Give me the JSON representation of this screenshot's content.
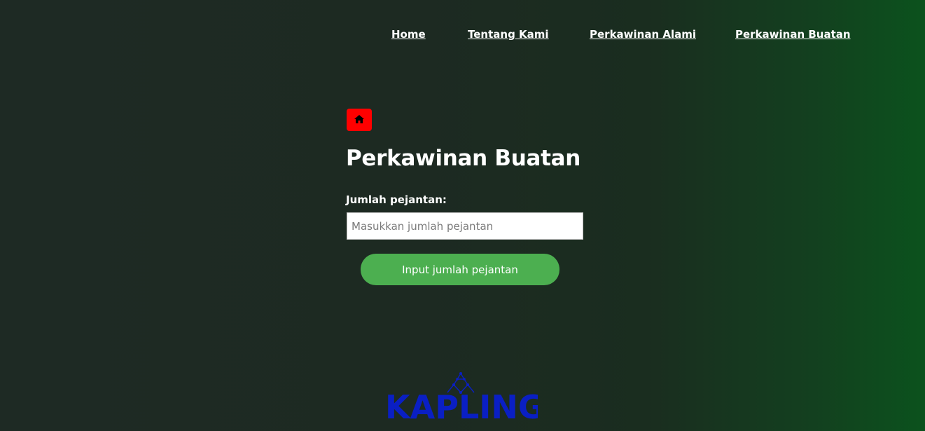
{
  "nav": {
    "items": [
      {
        "label": "Home"
      },
      {
        "label": "Tentang Kami"
      },
      {
        "label": "Perkawinan Alami"
      },
      {
        "label": "Perkawinan Buatan"
      }
    ]
  },
  "home_button": {
    "icon": "home-icon",
    "color": "#ff0000"
  },
  "main": {
    "title": "Perkawinan Buatan",
    "field_label": "Jumlah pejantan:",
    "input": {
      "value": "",
      "placeholder": "Masukkan jumlah pejantan"
    },
    "submit_label": "Input jumlah pejantan",
    "submit_color": "#4caf50"
  },
  "footer": {
    "logo_text": "KAPLING",
    "logo_color": "#0a1fc4",
    "logo_icon": "network-mountain-icon"
  }
}
